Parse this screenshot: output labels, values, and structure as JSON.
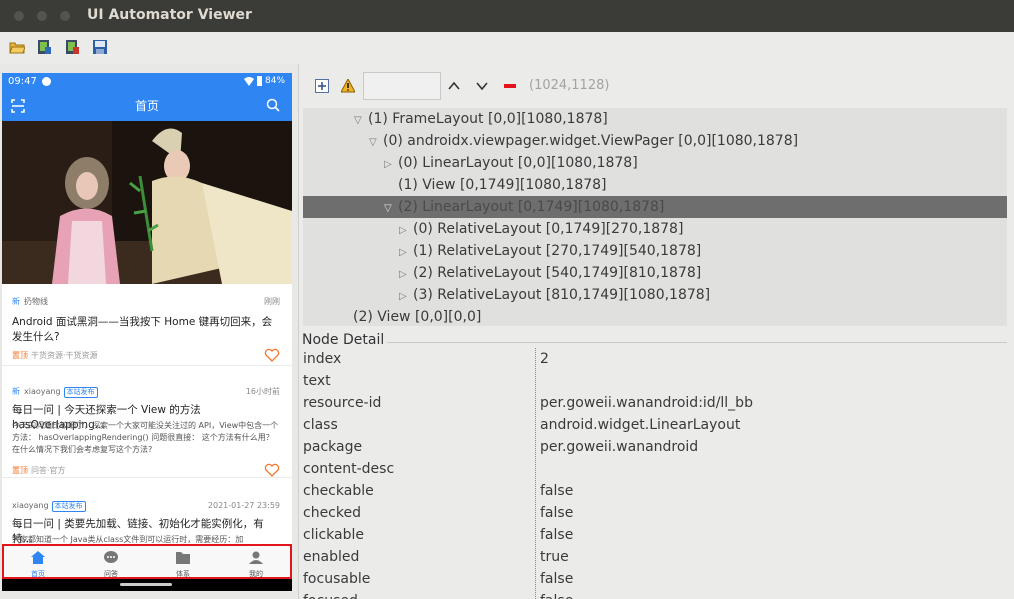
{
  "window": {
    "title": "UI Automator Viewer"
  },
  "phone": {
    "status": {
      "time": "09:47",
      "battery": "84%"
    },
    "appbar": {
      "title": "首页"
    },
    "articles": [
      {
        "new": "新",
        "author": "扔物线",
        "badge": "",
        "time": "刚刚",
        "title": "Android 面试黑洞——当我按下 Home 键再切回来，会发生什么?",
        "desc": "",
        "top": "置顶",
        "tags": "干货资源·干货资源"
      },
      {
        "new": "新",
        "author": "xiaoyang",
        "badge": "本站发布",
        "time": "16小时前",
        "title": "每日一问 | 今天还探索一个 View 的方法 hasOverlapping...",
        "desc": "今天的问题比较细了，探索一个大家可能没关注过的 API，View中包含一个方法： hasOverlappingRendering() 问题很直接： 这个方法有什么用？ 在什么情况下我们会考虑复写这个方法?",
        "top": "置顶",
        "tags": "问答·官方"
      },
      {
        "new": "",
        "author": "xiaoyang",
        "badge": "本站发布",
        "time": "2021-01-27 23:59",
        "title": "每日一问 | 类要先加载、链接、初始化才能实例化，有特...",
        "desc": "大家都知道一个 Java类从class文件到可以运行时，需要经历：加",
        "top": "",
        "tags": ""
      }
    ],
    "nav": [
      {
        "label": "首页",
        "icon": "home-icon",
        "active": true
      },
      {
        "label": "问答",
        "icon": "chat-icon",
        "active": false
      },
      {
        "label": "体系",
        "icon": "folder-icon",
        "active": false
      },
      {
        "label": "我的",
        "icon": "person-icon",
        "active": false
      }
    ]
  },
  "inspector": {
    "coords": "(1024,1128)",
    "tree": [
      {
        "indent": 1,
        "toggle": "open",
        "text": "(1) FrameLayout [0,0][1080,1878]",
        "selected": false
      },
      {
        "indent": 2,
        "toggle": "open",
        "text": "(0) androidx.viewpager.widget.ViewPager [0,0][1080,1878]",
        "selected": false
      },
      {
        "indent": 3,
        "toggle": "closed",
        "text": "(0) LinearLayout [0,0][1080,1878]",
        "selected": false
      },
      {
        "indent": 3,
        "toggle": "none",
        "text": "(1) View [0,1749][1080,1878]",
        "selected": false
      },
      {
        "indent": 3,
        "toggle": "open",
        "text": "(2) LinearLayout [0,1749][1080,1878]",
        "selected": true
      },
      {
        "indent": 4,
        "toggle": "closed",
        "text": "(0) RelativeLayout [0,1749][270,1878]",
        "selected": false
      },
      {
        "indent": 4,
        "toggle": "closed",
        "text": "(1) RelativeLayout [270,1749][540,1878]",
        "selected": false
      },
      {
        "indent": 4,
        "toggle": "closed",
        "text": "(2) RelativeLayout [540,1749][810,1878]",
        "selected": false
      },
      {
        "indent": 4,
        "toggle": "closed",
        "text": "(3) RelativeLayout [810,1749][1080,1878]",
        "selected": false
      },
      {
        "indent": 0,
        "toggle": "none",
        "text": "(2) View [0,0][0,0]",
        "selected": false
      }
    ],
    "detail_title": "Node Detail",
    "properties": [
      {
        "key": "index",
        "value": "2"
      },
      {
        "key": "text",
        "value": ""
      },
      {
        "key": "resource-id",
        "value": "per.goweii.wanandroid:id/ll_bb"
      },
      {
        "key": "class",
        "value": "android.widget.LinearLayout"
      },
      {
        "key": "package",
        "value": "per.goweii.wanandroid"
      },
      {
        "key": "content-desc",
        "value": ""
      },
      {
        "key": "checkable",
        "value": "false"
      },
      {
        "key": "checked",
        "value": "false"
      },
      {
        "key": "clickable",
        "value": "false"
      },
      {
        "key": "enabled",
        "value": "true"
      },
      {
        "key": "focusable",
        "value": "false"
      },
      {
        "key": "focused",
        "value": "false"
      }
    ]
  },
  "colors": {
    "accent": "#2f86f2",
    "highlight": "#e3141b",
    "selected_row": "#6e6e6e"
  }
}
